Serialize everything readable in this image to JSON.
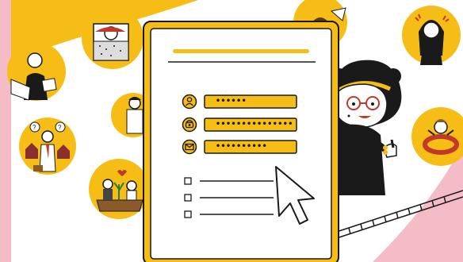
{
  "colors": {
    "background_pink": "#f4bcc6",
    "accent_yellow": "#f6bd16",
    "ink": "#1a1a1a",
    "paper": "#ffffff"
  },
  "form": {
    "fields": [
      {
        "icon": "user-icon",
        "value": "••••••"
      },
      {
        "icon": "phone-icon",
        "value": "•••••••••••••••"
      },
      {
        "icon": "mail-icon",
        "value": "••••••••••"
      }
    ],
    "checkboxes": [
      {
        "checked": false
      },
      {
        "checked": false
      },
      {
        "checked": false
      }
    ]
  },
  "illustrations": [
    "woman-with-papers-portrait",
    "person-sleeping-in-bed-portrait",
    "man-in-doorway-portrait",
    "confused-man-with-houses-portrait",
    "couple-with-plant-portrait",
    "person-with-cat-portrait",
    "woman-holding-head-portrait",
    "man-in-lifebuoy-portrait",
    "woman-with-glasses-thumbs-up"
  ]
}
